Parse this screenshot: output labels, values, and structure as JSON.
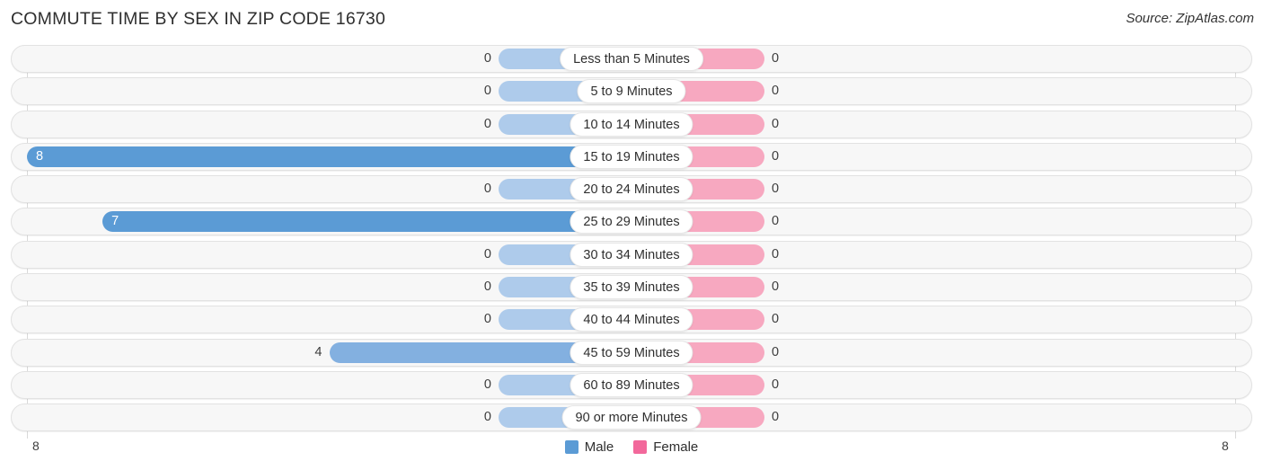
{
  "header": {
    "title": "COMMUTE TIME BY SEX IN ZIP CODE 16730",
    "source": "Source: ZipAtlas.com"
  },
  "legend": {
    "male_label": "Male",
    "female_label": "Female",
    "male_color": "#5b9bd5",
    "female_color": "#f2689b"
  },
  "axis": {
    "left_label": "8",
    "right_label": "8"
  },
  "colors": {
    "bar_male_zero": "#aecbeb",
    "bar_male_low": "#83b0e0",
    "bar_male_high": "#5b9bd5",
    "bar_female_zero": "#f7a8c0",
    "track": "#f7f7f7",
    "gridline": "#d9d9d9"
  },
  "chart_data": {
    "type": "bar",
    "title": "COMMUTE TIME BY SEX IN ZIP CODE 16730",
    "subtitle": "",
    "orientation": "horizontal-diverging",
    "xlabel": "",
    "ylabel": "",
    "xlim": [
      8,
      8
    ],
    "grid": true,
    "legend_position": "bottom-center",
    "categories": [
      "Less than 5 Minutes",
      "5 to 9 Minutes",
      "10 to 14 Minutes",
      "15 to 19 Minutes",
      "20 to 24 Minutes",
      "25 to 29 Minutes",
      "30 to 34 Minutes",
      "35 to 39 Minutes",
      "40 to 44 Minutes",
      "45 to 59 Minutes",
      "60 to 89 Minutes",
      "90 or more Minutes"
    ],
    "series": [
      {
        "name": "Male",
        "values": [
          0,
          0,
          0,
          8,
          0,
          7,
          0,
          0,
          0,
          4,
          0,
          0
        ]
      },
      {
        "name": "Female",
        "values": [
          0,
          0,
          0,
          0,
          0,
          0,
          0,
          0,
          0,
          0,
          0,
          0
        ]
      }
    ],
    "max_value": 8
  }
}
